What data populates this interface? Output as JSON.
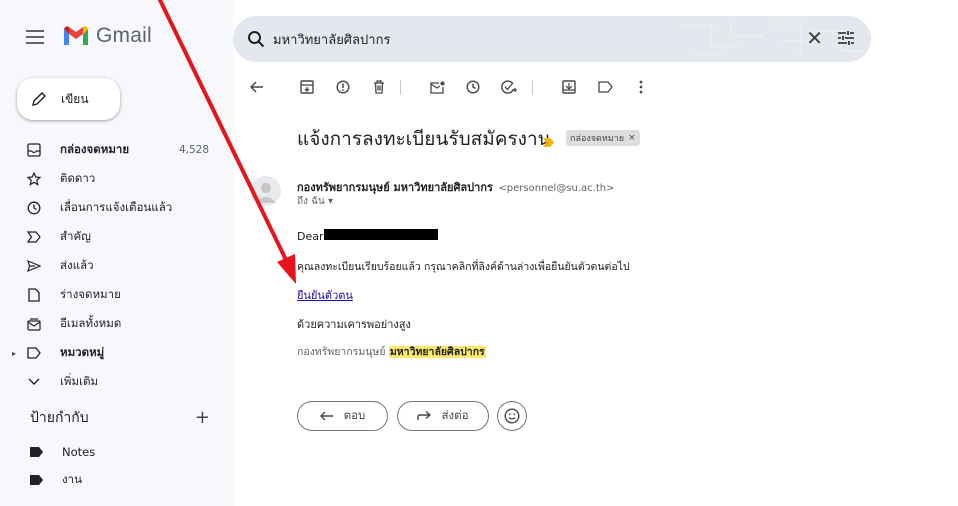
{
  "app": {
    "name": "Gmail"
  },
  "sidebar": {
    "compose_label": "เขียน",
    "items": [
      {
        "label": "กล่องจดหมาย",
        "count": "4,528",
        "icon": "inbox-icon",
        "bold": true
      },
      {
        "label": "ติดดาว",
        "icon": "star-icon"
      },
      {
        "label": "เลื่อนการแจ้งเตือนแล้ว",
        "icon": "clock-icon"
      },
      {
        "label": "สำคัญ",
        "icon": "important-icon"
      },
      {
        "label": "ส่งแล้ว",
        "icon": "send-icon"
      },
      {
        "label": "ร่างจดหมาย",
        "icon": "draft-icon"
      },
      {
        "label": "อีเมลทั้งหมด",
        "icon": "all-mail-icon"
      },
      {
        "label": "หมวดหมู่",
        "icon": "label-icon",
        "bold": true
      },
      {
        "label": "เพิ่มเติม",
        "icon": "chevron-down-icon"
      }
    ],
    "labels_title": "ป้ายกำกับ",
    "labels_add": "+",
    "labels": [
      {
        "label": "Notes"
      },
      {
        "label": "งาน"
      }
    ]
  },
  "search": {
    "query": "มหาวิทยาลัยศิลปากร",
    "close_glyph": "✕"
  },
  "message": {
    "subject": "แจ้งการลงทะเบียนรับสมัครงาน",
    "chip_label": "กล่องจดหมาย",
    "chip_close": "×",
    "sender_name": "กองทรัพยากรมนุษย์ มหาวิทยาลัยศิลปากร",
    "sender_email": "<personnel@su.ac.th>",
    "to_line": "ถึง ฉัน ▾",
    "dear": "Dear",
    "body_line": "คุณลงทะเบียนเรียบร้อยแล้ว กรุณาคลิกที่ลิงค์ด้านล่างเพื่อยืนยันตัวตนต่อไป",
    "link_text": "ยืนยันตัวตน",
    "regards": "ด้วยความเคารพอย่างสูง",
    "sig_prefix": "กองทรัพยากรมนุษย์ ",
    "sig_highlight": "มหาวิทยาลัยศิลปากร"
  },
  "actions": {
    "reply_label": "ตอบ",
    "forward_label": "ส่งต่อ"
  },
  "colors": {
    "annotation_arrow": "#e8141b",
    "highlight": "#fde96a",
    "link": "#1a0dab"
  }
}
